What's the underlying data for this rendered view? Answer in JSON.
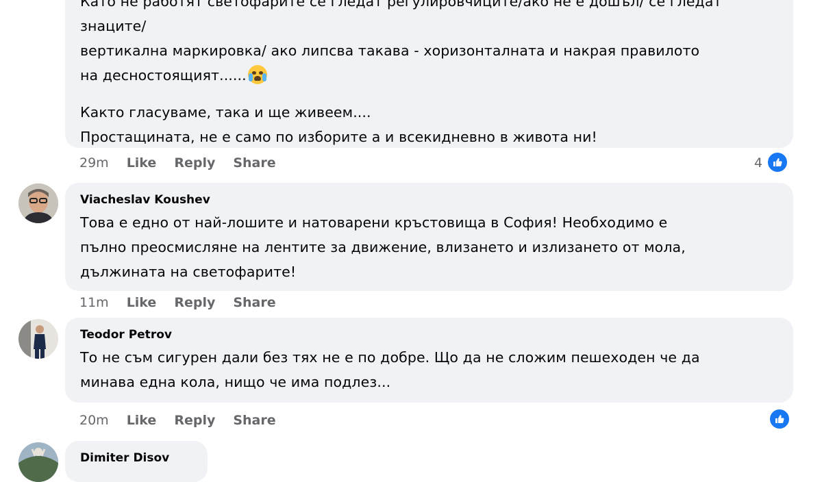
{
  "comment1": {
    "lines": [
      "Като не работят светофарите се гледат регулировчиците/ако не е дошъл/ се гледат",
      "знаците/",
      "вертикална маркировка/ ако липсва такава - хоризонталната и накрая правилото",
      "на десностоящият......",
      "Както гласуваме, така и ще живеем....",
      "Простащината, не е само по изборите а и всекидневно в живота ни!"
    ],
    "emoji": "crying-face",
    "time": "29m",
    "like": "Like",
    "reply": "Reply",
    "share": "Share",
    "reactions": "4"
  },
  "comment2": {
    "author": "Viacheslav Koushev",
    "lines": [
      "Това е едно от най-лошите и натоварени кръстовища в София! Необходимо е",
      "пълно преосмисляне на лентите за движение, влизането и излизането от мола,",
      "дължината на светофарите!"
    ],
    "time": "11m",
    "like": "Like",
    "reply": "Reply",
    "share": "Share"
  },
  "comment3": {
    "author": "Teodor Petrov",
    "lines": [
      "То не съм сигурен дали без тях не е по добре. Що да не сложим пешеходен че да",
      "минава една кола, нищо че има подлез..."
    ],
    "time": "20m",
    "like": "Like",
    "reply": "Reply",
    "share": "Share"
  },
  "comment4": {
    "author": "Dimiter Disov"
  },
  "colors": {
    "bubble": "#f0f2f5",
    "meta": "#65676b",
    "like_blue": "#1877f2"
  }
}
